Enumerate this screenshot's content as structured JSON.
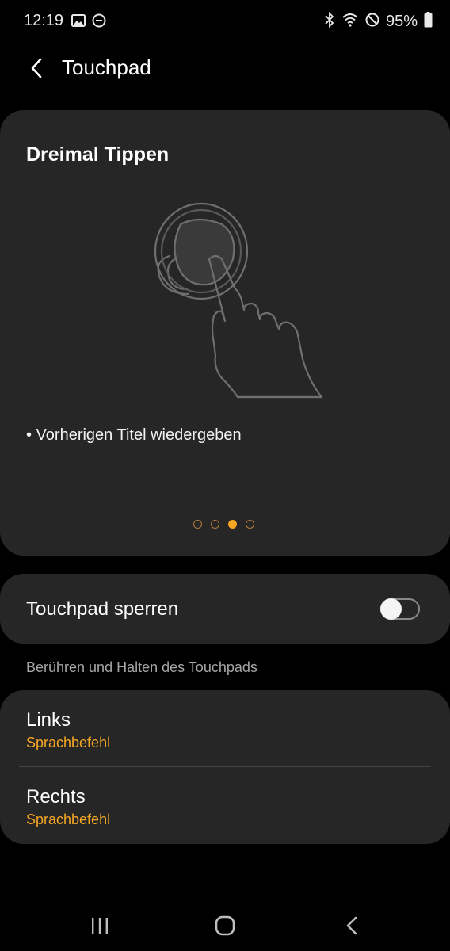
{
  "status_bar": {
    "time": "12:19",
    "battery_pct": "95%",
    "icons_left": [
      "image-icon",
      "dnd-icon"
    ],
    "icons_right": [
      "bluetooth-icon",
      "wifi-icon",
      "blocked-icon",
      "battery-icon"
    ]
  },
  "header": {
    "title": "Touchpad"
  },
  "tutorial": {
    "title": "Dreimal Tippen",
    "description": "• Vorherigen Titel wiedergeben",
    "page_count": 4,
    "active_page": 3
  },
  "lock": {
    "label": "Touchpad sperren",
    "enabled": false
  },
  "hold_section": {
    "label": "Berühren und Halten des Touchpads",
    "items": [
      {
        "title": "Links",
        "value": "Sprachbefehl"
      },
      {
        "title": "Rechts",
        "value": "Sprachbefehl"
      }
    ]
  },
  "colors": {
    "accent": "#f5a623",
    "card": "#262626",
    "background": "#000000"
  }
}
